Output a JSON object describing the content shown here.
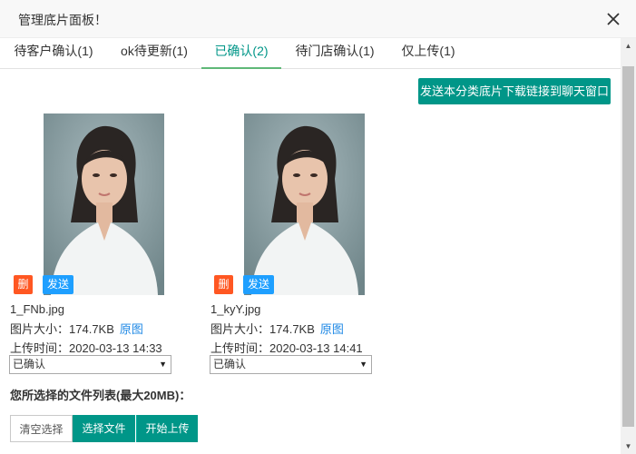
{
  "header": {
    "title": "管理底片面板！"
  },
  "tabs": [
    {
      "label": "待客户确认(1)"
    },
    {
      "label": "ok待更新(1)"
    },
    {
      "label": "已确认(2)"
    },
    {
      "label": "待门店确认(1)"
    },
    {
      "label": "仅上传(1)"
    }
  ],
  "active_tab": "已确认(2)",
  "send_link_button": "发送本分类底片下载链接到聊天窗口",
  "photos": [
    {
      "delete_tag": "删",
      "send_tag": "发送",
      "filename": "1_FNb.jpg",
      "size_label": "图片大小：",
      "size": "174.7KB",
      "original_link": "原图",
      "upload_label": "上传时间：",
      "upload_time": "2020-03-13 14:33",
      "status": "已确认"
    },
    {
      "delete_tag": "删",
      "send_tag": "发送",
      "filename": "1_kyY.jpg",
      "size_label": "图片大小：",
      "size": "174.7KB",
      "original_link": "原图",
      "upload_label": "上传时间：",
      "upload_time": "2020-03-13 14:41",
      "status": "已确认"
    }
  ],
  "files_section": {
    "label": "您所选择的文件列表(最大20MB)："
  },
  "buttons": {
    "clear": "清空选择",
    "choose": "选择文件",
    "upload": "开始上传"
  },
  "colors": {
    "accent": "#009688",
    "delete": "#ff5722",
    "send": "#1e9fff",
    "link": "#1e88e5"
  }
}
